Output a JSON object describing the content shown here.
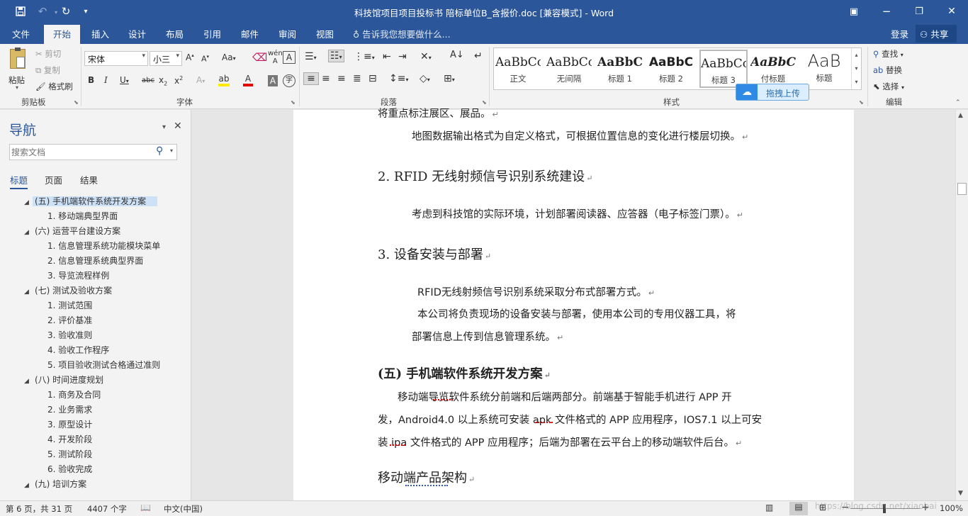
{
  "title_bar": {
    "title": "科技馆项目项目投标书 陪标单位B_含报价.doc [兼容模式] - Word"
  },
  "menu": {
    "tabs": [
      "文件",
      "开始",
      "插入",
      "设计",
      "布局",
      "引用",
      "邮件",
      "审阅",
      "视图"
    ],
    "tell_me": "告诉我您想要做什么...",
    "login": "登录",
    "share": "共享"
  },
  "ribbon": {
    "clipboard": {
      "paste": "粘贴",
      "cut": "剪切",
      "copy": "复制",
      "format_painter": "格式刷",
      "group": "剪贴板"
    },
    "font": {
      "name": "宋体",
      "size": "小三",
      "group": "字体"
    },
    "paragraph": {
      "group": "段落"
    },
    "styles": {
      "group": "样式",
      "items": [
        {
          "sample": "AaBbCcI",
          "name": "正文"
        },
        {
          "sample": "AaBbCcI",
          "name": "无间隔"
        },
        {
          "sample": "AaBbC",
          "name": "标题 1"
        },
        {
          "sample": "AaBbC",
          "name": "标题 2"
        },
        {
          "sample": "AaBbCc",
          "name": "标题 3"
        },
        {
          "sample": "AaBbC",
          "name": "付标题"
        },
        {
          "sample": "AaB",
          "name": "标题"
        }
      ],
      "upload_popup": "拖拽上传"
    },
    "editing": {
      "find": "查找",
      "replace": "替换",
      "select": "选择",
      "group": "编辑"
    }
  },
  "navigation": {
    "title": "导航",
    "search_placeholder": "搜索文档",
    "tabs": [
      "标题",
      "页面",
      "结果"
    ],
    "items": [
      {
        "text": "(五) 手机端软件系统开发方案",
        "level": 1,
        "expanded": true,
        "selected": true
      },
      {
        "text": "1. 移动端典型界面",
        "level": 2
      },
      {
        "text": "(六) 运营平台建设方案",
        "level": 1,
        "expanded": true
      },
      {
        "text": "1. 信息管理系统功能模块菜单",
        "level": 2
      },
      {
        "text": "2. 信息管理系统典型界面",
        "level": 2
      },
      {
        "text": "3. 导览流程样例",
        "level": 2
      },
      {
        "text": "(七) 测试及验收方案",
        "level": 1,
        "expanded": true
      },
      {
        "text": "1. 测试范围",
        "level": 2
      },
      {
        "text": "2. 评价基准",
        "level": 2
      },
      {
        "text": "3. 验收准则",
        "level": 2
      },
      {
        "text": "4. 验收工作程序",
        "level": 2
      },
      {
        "text": "5. 项目验收测试合格通过准则",
        "level": 2
      },
      {
        "text": "(八) 时间进度规划",
        "level": 1,
        "expanded": true
      },
      {
        "text": "1. 商务及合同",
        "level": 2
      },
      {
        "text": "2. 业务需求",
        "level": 2
      },
      {
        "text": "3. 原型设计",
        "level": 2
      },
      {
        "text": "4. 开发阶段",
        "level": 2
      },
      {
        "text": "5. 测试阶段",
        "level": 2
      },
      {
        "text": "6. 验收完成",
        "level": 2
      },
      {
        "text": "(九) 培训方案",
        "level": 1,
        "expanded": true
      }
    ]
  },
  "document": {
    "lines": {
      "l0": "将重点标注展区、展品。",
      "l1": "地图数据输出格式为自定义格式，可根据位置信息的变化进行楼层切换。",
      "h2": "2.  RFID 无线射频信号识别系统建设",
      "l3": "考虑到科技馆的实际环境，计划部署阅读器、应答器（电子标签门票）。",
      "h4": "3.  设备安装与部署",
      "l5": "RFID无线射频信号识别系统采取分布式部署方式。",
      "l6": "本公司将负责现场的设备安装与部署，使用本公司的专用仪器工具，将",
      "l7": "部署信息上传到信息管理系统。",
      "h8": "(五)    手机端软件系统开发方案",
      "l9": "移动端导览软件系统分前端和后端两部分。前端基于智能手机进行 APP 开",
      "l10": "发，Android4.0 以上系统可安装 apk 文件格式的 APP 应用程序，IOS7.1 以上可安",
      "l11": "装 ipa 文件格式的 APP 应用程序；后端为部署在云平台上的移动端软件后台。",
      "h12": "移动端产品架构"
    }
  },
  "status": {
    "page": "第 6 页，共 31 页",
    "words": "4407 个字",
    "language": "中文(中国)",
    "zoom": "100%",
    "watermark": "https://blog.csdn.net/xiaobai"
  }
}
